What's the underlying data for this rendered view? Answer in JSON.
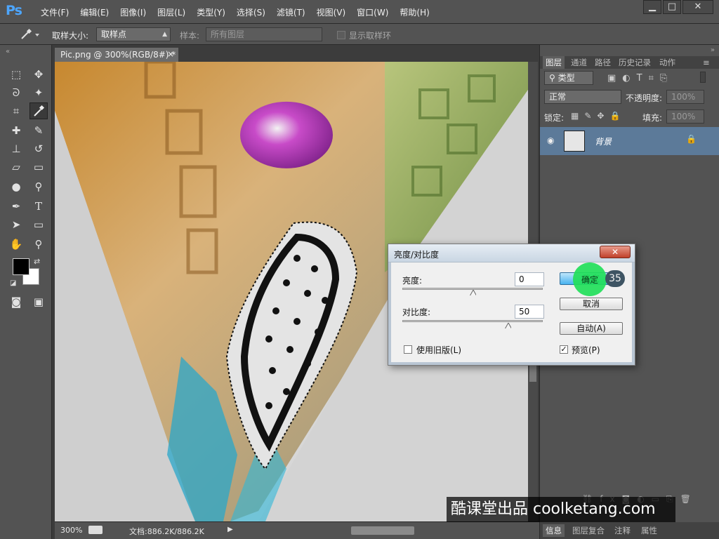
{
  "app": {
    "logo": "Ps",
    "menu": [
      "文件(F)",
      "编辑(E)",
      "图像(I)",
      "图层(L)",
      "类型(Y)",
      "选择(S)",
      "滤镜(T)",
      "视图(V)",
      "窗口(W)",
      "帮助(H)"
    ],
    "window_controls": [
      "▁",
      "□",
      "✕"
    ]
  },
  "options": {
    "sample_size_label": "取样大小:",
    "sample_size_value": "取样点",
    "sample_label": "样本:",
    "sample_value": "所有图层",
    "show_ring_label": "显示取样环"
  },
  "document": {
    "tab_title": "Pic.png @ 300%(RGB/8#) *",
    "tab_close": "×",
    "status_zoom": "300%",
    "status_doc": "文档:886.2K/886.2K",
    "status_arrow": "▶"
  },
  "panels": {
    "tabs": [
      "图层",
      "通道",
      "路径",
      "历史记录",
      "动作"
    ],
    "filter_kind": "类型",
    "blend_mode": "正常",
    "opacity_label": "不透明度:",
    "opacity_value": "100%",
    "lock_label": "锁定:",
    "fill_label": "填充:",
    "fill_value": "100%",
    "layer_name": "背景",
    "bottom_tabs": [
      "信息",
      "图层复合",
      "注释",
      "属性"
    ]
  },
  "dialog": {
    "title": "亮度/对比度",
    "close": "✕",
    "brightness_label": "亮度:",
    "brightness_value": "0",
    "contrast_label": "对比度:",
    "contrast_value": "50",
    "legacy_label": "使用旧版(L)",
    "preview_label": "预览(P)",
    "preview_check": "✓",
    "ok": "确定",
    "cancel": "取消",
    "auto": "自动(A)"
  },
  "overlay": {
    "step_number": "35",
    "watermark": "酷课堂出品 coolketang.com"
  },
  "colors": {
    "accent_blue": "#4da6ff",
    "layer_selected": "#5c7a99",
    "click_indicator": "#22e05a"
  }
}
